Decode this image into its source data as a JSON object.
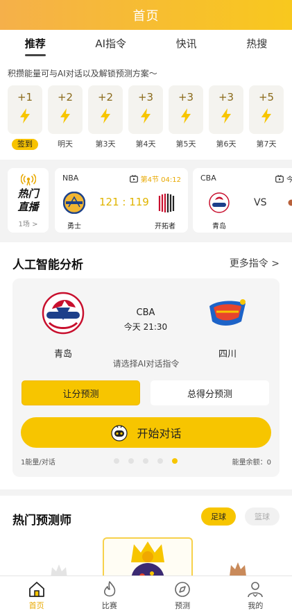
{
  "header": {
    "title": "首页"
  },
  "tabs": [
    {
      "label": "推荐",
      "active": true
    },
    {
      "label": "AI指令"
    },
    {
      "label": "快讯"
    },
    {
      "label": "热搜"
    }
  ],
  "energy": {
    "note": "积攒能量可与AI对话以及解锁预测方案～",
    "days": [
      {
        "points": "+1",
        "label": "签到",
        "today": true
      },
      {
        "points": "+2",
        "label": "明天"
      },
      {
        "points": "+2",
        "label": "第3天"
      },
      {
        "points": "+3",
        "label": "第4天"
      },
      {
        "points": "+3",
        "label": "第5天"
      },
      {
        "points": "+3",
        "label": "第6天"
      },
      {
        "points": "+5",
        "label": "第7天"
      }
    ]
  },
  "live": {
    "title": "热门直播",
    "count": "1场 >",
    "matches": [
      {
        "league": "NBA",
        "status": "第4节 04:12",
        "home": "勇士",
        "score": "121 : 119",
        "away": "开拓者"
      },
      {
        "league": "CBA",
        "status": "今",
        "home": "青岛",
        "vs": "VS",
        "away": ""
      }
    ]
  },
  "ai_analysis": {
    "title": "人工智能分析",
    "more": "更多指令 >",
    "league": "CBA",
    "time": "今天 21:30",
    "home": "青岛",
    "away": "四川",
    "prompt": "请选择AI对话指令",
    "options": [
      {
        "label": "让分预测",
        "selected": true
      },
      {
        "label": "总得分预测"
      }
    ],
    "start_label": "开始对话",
    "cost": "1能量/对话",
    "balance": "能量余额：0",
    "page_count": 5,
    "page_active": 5
  },
  "experts": {
    "title": "热门预测师",
    "sports": [
      {
        "label": "足球",
        "active": true
      },
      {
        "label": "篮球"
      }
    ]
  },
  "nav": [
    {
      "label": "首页",
      "icon": "home-icon",
      "active": true
    },
    {
      "label": "比赛",
      "icon": "flame-icon"
    },
    {
      "label": "预测",
      "icon": "compass-icon"
    },
    {
      "label": "我的",
      "icon": "user-icon"
    }
  ],
  "colors": {
    "accent": "#f7c500",
    "header": "#f7bf2e",
    "active_text": "#e8a800"
  }
}
